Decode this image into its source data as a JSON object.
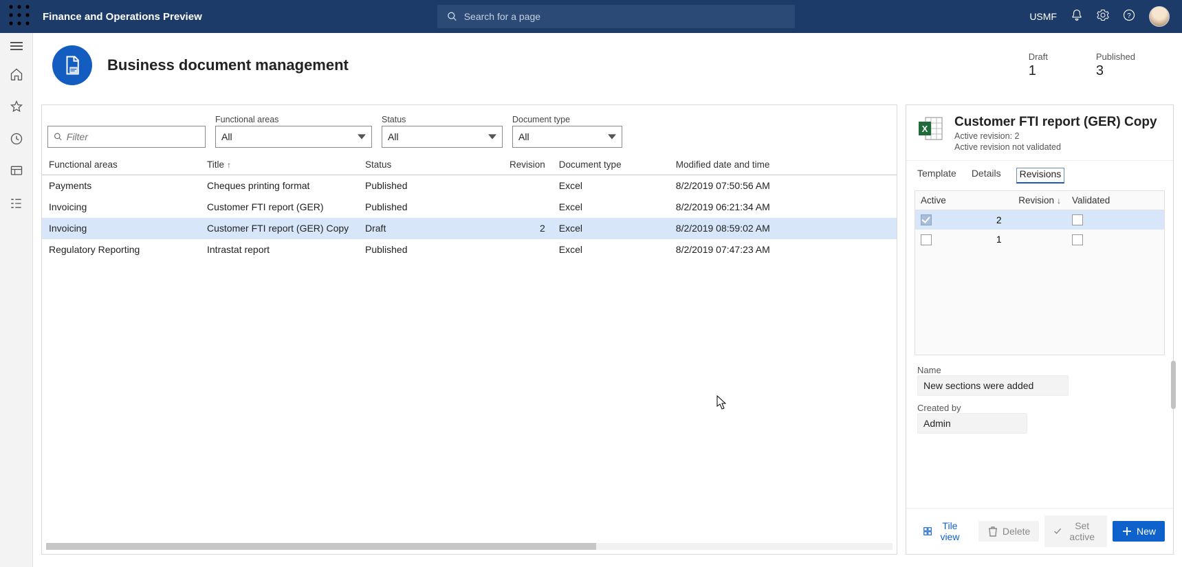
{
  "topbar": {
    "app_title": "Finance and Operations Preview",
    "search_placeholder": "Search for a page",
    "company": "USMF"
  },
  "page": {
    "title": "Business document management",
    "stats": {
      "draft_label": "Draft",
      "draft_count": "1",
      "published_label": "Published",
      "published_count": "3"
    }
  },
  "filters": {
    "filter_placeholder": "Filter",
    "functional_areas": {
      "label": "Functional areas",
      "value": "All"
    },
    "status": {
      "label": "Status",
      "value": "All"
    },
    "doc_type": {
      "label": "Document type",
      "value": "All"
    }
  },
  "grid": {
    "headers": {
      "area": "Functional areas",
      "title": "Title",
      "status": "Status",
      "revision": "Revision",
      "doctype": "Document type",
      "modified": "Modified date and time"
    },
    "rows": [
      {
        "area": "Payments",
        "title": "Cheques printing format",
        "status": "Published",
        "revision": "",
        "doctype": "Excel",
        "modified": "8/2/2019 07:50:56 AM"
      },
      {
        "area": "Invoicing",
        "title": "Customer FTI report (GER)",
        "status": "Published",
        "revision": "",
        "doctype": "Excel",
        "modified": "8/2/2019 06:21:34 AM"
      },
      {
        "area": "Invoicing",
        "title": "Customer FTI report (GER) Copy",
        "status": "Draft",
        "revision": "2",
        "doctype": "Excel",
        "modified": "8/2/2019 08:59:02 AM"
      },
      {
        "area": "Regulatory Reporting",
        "title": "Intrastat report",
        "status": "Published",
        "revision": "",
        "doctype": "Excel",
        "modified": "8/2/2019 07:47:23 AM"
      }
    ]
  },
  "side": {
    "title": "Customer FTI report (GER) Copy",
    "active_rev_label": "Active revision: 2",
    "active_rev_status": "Active revision not validated",
    "tabs": {
      "template": "Template",
      "details": "Details",
      "revisions": "Revisions"
    },
    "rev_headers": {
      "active": "Active",
      "revision": "Revision",
      "validated": "Validated"
    },
    "rev_rows": [
      {
        "rev": "2"
      },
      {
        "rev": "1"
      }
    ],
    "fields": {
      "name_label": "Name",
      "name_value": "New sections were added",
      "createdby_label": "Created by",
      "createdby_value": "Admin"
    },
    "actions": {
      "tile": "Tile view",
      "delete": "Delete",
      "setactive": "Set active",
      "new": "New"
    }
  }
}
